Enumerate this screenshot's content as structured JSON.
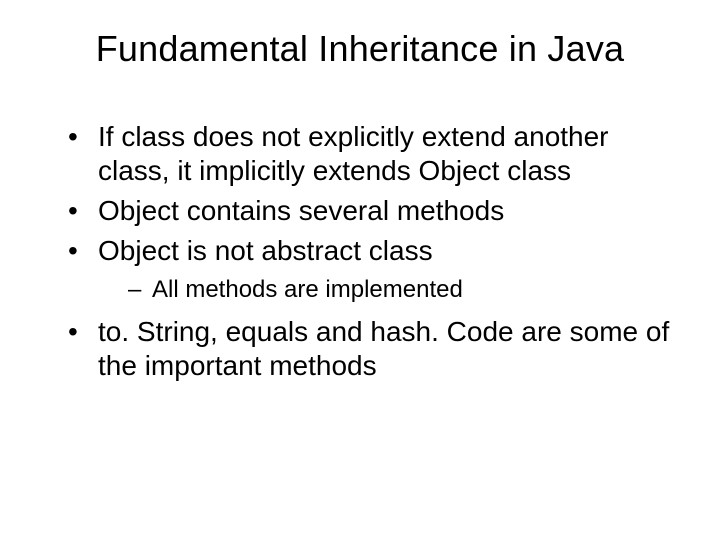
{
  "title": "Fundamental Inheritance in Java",
  "bullets": {
    "b1": "If class does not explicitly extend another class, it implicitly extends Object class",
    "b2": "Object contains several methods",
    "b3": "Object is not abstract class",
    "b3_sub1": "All methods are implemented",
    "b4": "to. String, equals and hash. Code are some of the important methods"
  }
}
